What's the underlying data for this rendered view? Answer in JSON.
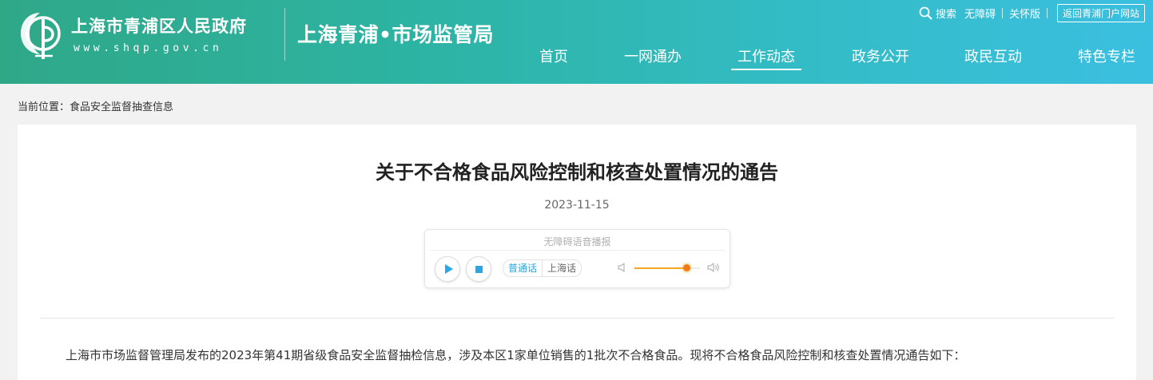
{
  "header": {
    "gov_name": "上海市青浦区人民政府",
    "gov_url": "www.shqp.gov.cn",
    "site_name": "上海青浦•市场监管局",
    "toplinks": {
      "search": "搜索",
      "accessible": "无障碍",
      "elder": "关怀版",
      "return": "返回青浦门户网站"
    },
    "nav": [
      {
        "label": "首页",
        "active": false
      },
      {
        "label": "一网通办",
        "active": false
      },
      {
        "label": "工作动态",
        "active": true
      },
      {
        "label": "政务公开",
        "active": false
      },
      {
        "label": "政民互动",
        "active": false
      },
      {
        "label": "特色专栏",
        "active": false
      }
    ],
    "colors": {
      "gradient_start": "#2fa888",
      "gradient_end": "#3bbfe0",
      "text": "#ffffff"
    }
  },
  "breadcrumb": {
    "prefix": "当前位置：",
    "current": "食品安全监督抽查信息"
  },
  "article": {
    "title": "关于不合格食品风险控制和核查处置情况的通告",
    "date": "2023-11-15",
    "player": {
      "title": "无障碍语音播报",
      "dialects": [
        "普通话",
        "上海话"
      ],
      "active_dialect": "普通话",
      "volume_fraction": 0.8,
      "accent_color": "#2aa6e6",
      "volume_color": "#f5a623",
      "icons": [
        "play-icon",
        "stop-icon",
        "volume-low-icon",
        "volume-high-icon"
      ]
    },
    "body": "上海市市场监督管理局发布的2023年第41期省级食品安全监督抽检信息，涉及本区1家单位销售的1批次不合格食品。现将不合格食品风险控制和核查处置情况通告如下："
  }
}
